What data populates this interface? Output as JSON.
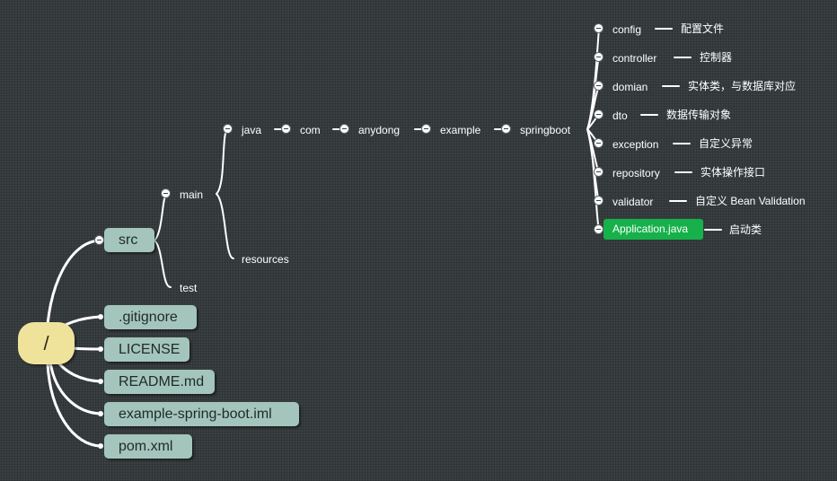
{
  "colors": {
    "background": "#3a4042",
    "root_fill": "#efe39c",
    "box_fill": "#a4c5bc",
    "highlight_fill": "#16b14b",
    "link": "#ffffff"
  },
  "root": {
    "label": "/"
  },
  "top_level": [
    "src",
    ".gitignore",
    "LICENSE",
    "README.md",
    "example-spring-boot.iml",
    "pom.xml"
  ],
  "src_children": {
    "main": "main",
    "test": "test"
  },
  "main_children": {
    "java": "java",
    "resources": "resources"
  },
  "package_path": [
    "com",
    "anydong",
    "example",
    "springboot"
  ],
  "packages": [
    {
      "name": "config",
      "note": "配置文件"
    },
    {
      "name": "controller",
      "note": "控制器"
    },
    {
      "name": "domian",
      "note": "实体类，与数据库对应"
    },
    {
      "name": "dto",
      "note": "数据传输对象"
    },
    {
      "name": "exception",
      "note": "自定义异常"
    },
    {
      "name": "repository",
      "note": "实体操作接口"
    },
    {
      "name": "validator",
      "note": "自定义 Bean Validation"
    },
    {
      "name": "Application.java",
      "note": "启动类"
    }
  ]
}
